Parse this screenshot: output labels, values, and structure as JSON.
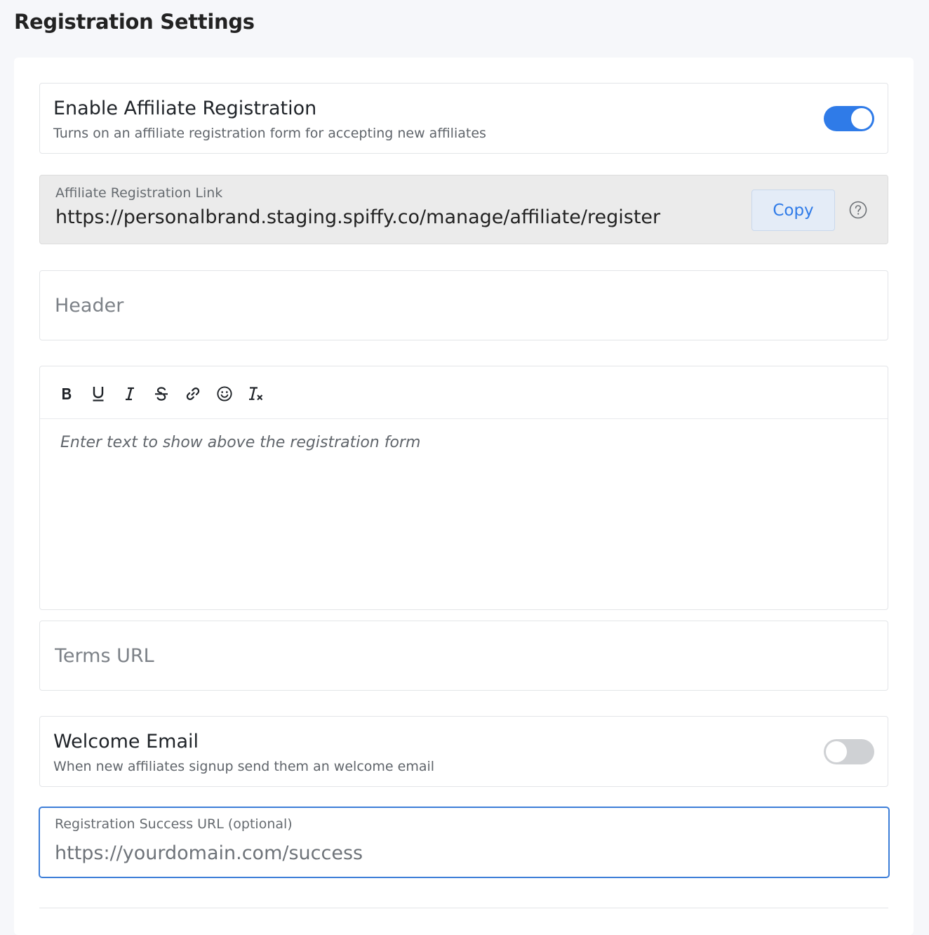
{
  "page": {
    "title": "Registration Settings"
  },
  "enable_registration": {
    "title": "Enable Affiliate Registration",
    "description": "Turns on an affiliate registration form for accepting new affiliates",
    "enabled": true
  },
  "registration_link": {
    "label": "Affiliate Registration Link",
    "value": "https://personalbrand.staging.spiffy.co/manage/affiliate/register",
    "copy_label": "Copy",
    "help_icon": "question-circle-icon"
  },
  "header_field": {
    "placeholder": "Header",
    "value": ""
  },
  "editor": {
    "toolbar": [
      {
        "name": "bold",
        "glyph": "B"
      },
      {
        "name": "underline",
        "glyph": "U"
      },
      {
        "name": "italic",
        "glyph": "I"
      },
      {
        "name": "strikethrough",
        "glyph": "S"
      },
      {
        "name": "link",
        "glyph": "link"
      },
      {
        "name": "emoji",
        "glyph": "smiley"
      },
      {
        "name": "clear-format",
        "glyph": "Tx"
      }
    ],
    "placeholder": "Enter text to show above the registration form"
  },
  "terms_field": {
    "placeholder": "Terms URL",
    "value": ""
  },
  "welcome_email": {
    "title": "Welcome Email",
    "description": "When new affiliates signup send them an welcome email",
    "enabled": false
  },
  "success_url": {
    "label": "Registration Success URL (optional)",
    "placeholder": "https://yourdomain.com/success",
    "value": ""
  },
  "colors": {
    "accent": "#2f7be8",
    "focus_border": "#3d7ed8",
    "toggle_off": "#cfd1d4",
    "background": "#f6f7fa"
  }
}
